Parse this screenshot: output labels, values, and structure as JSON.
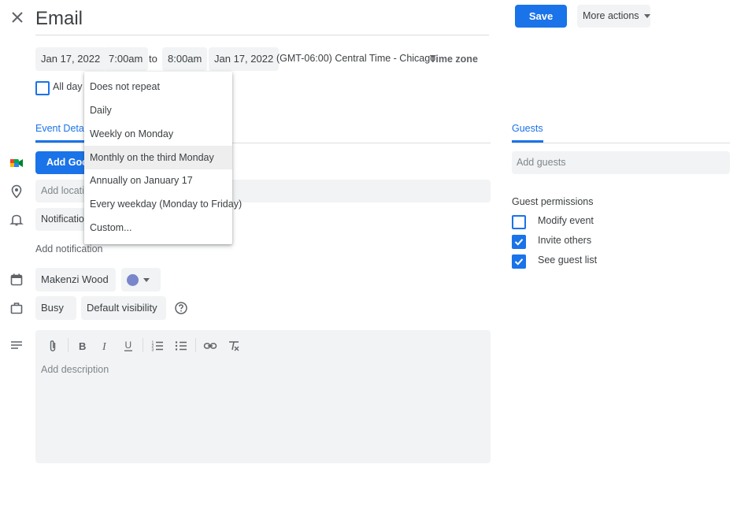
{
  "header": {
    "title": "Email",
    "close_icon": "close-icon",
    "save_label": "Save",
    "more_actions_label": "More actions"
  },
  "datetime": {
    "start_date": "Jan 17, 2022",
    "start_time": "7:00am",
    "to": "to",
    "end_time": "8:00am",
    "end_date": "Jan 17, 2022",
    "timezone_text": "(GMT-06:00) Central Time - Chicago",
    "timezone_button": "Time zone",
    "all_day_label": "All day"
  },
  "repeat_menu": {
    "items": [
      "Does not repeat",
      "Daily",
      "Weekly on Monday",
      "Monthly on the third Monday",
      "Annually on January 17",
      "Every weekday (Monday to Friday)",
      "Custom..."
    ],
    "highlighted_index": 3
  },
  "tabs": {
    "event_details": "Event Detai",
    "guests": "Guests"
  },
  "details": {
    "meet_button": "Add Goo",
    "location_placeholder": "Add locatio",
    "notification_chip": "Notificatio",
    "add_notification": "Add notification",
    "calendar_owner": "Makenzi Wood",
    "calendar_color": "#7986cb",
    "busy_label": "Busy",
    "visibility_label": "Default visibility",
    "description_placeholder": "Add description"
  },
  "guests": {
    "add_guests_placeholder": "Add guests",
    "permissions_title": "Guest permissions",
    "permissions": [
      {
        "label": "Modify event",
        "checked": false
      },
      {
        "label": "Invite others",
        "checked": true
      },
      {
        "label": "See guest list",
        "checked": true
      }
    ]
  },
  "colors": {
    "accent": "#1a73e8",
    "chip_bg": "#f1f3f4"
  }
}
